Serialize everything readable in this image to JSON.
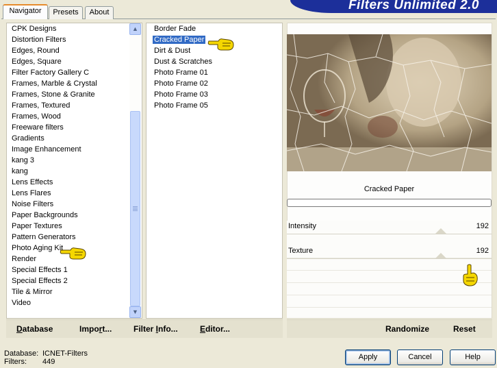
{
  "banner": {
    "title": "Filters Unlimited 2.0"
  },
  "tabs": [
    {
      "label": "Navigator",
      "active": true
    },
    {
      "label": "Presets",
      "active": false
    },
    {
      "label": "About",
      "active": false
    }
  ],
  "categories": [
    "CPK Designs",
    "Distortion Filters",
    "Edges, Round",
    "Edges, Square",
    "Filter Factory Gallery C",
    "Frames, Marble & Crystal",
    "Frames, Stone & Granite",
    "Frames, Textured",
    "Frames, Wood",
    "Freeware filters",
    "Gradients",
    "Image Enhancement",
    "kang 3",
    "kang",
    "Lens Effects",
    "Lens Flares",
    "Noise Filters",
    "Paper Backgrounds",
    "Paper Textures",
    "Pattern Generators",
    "Photo Aging Kit",
    "Render",
    "Special Effects 1",
    "Special Effects 2",
    "Tile & Mirror",
    "Video"
  ],
  "filters": [
    {
      "label": "Border Fade",
      "selected": false
    },
    {
      "label": "Cracked Paper",
      "selected": true
    },
    {
      "label": "Dirt & Dust",
      "selected": false
    },
    {
      "label": "Dust & Scratches",
      "selected": false
    },
    {
      "label": "Photo Frame 01",
      "selected": false
    },
    {
      "label": "Photo Frame 02",
      "selected": false
    },
    {
      "label": "Photo Frame 03",
      "selected": false
    },
    {
      "label": "Photo Frame 05",
      "selected": false
    }
  ],
  "bottom_bar": {
    "database": {
      "mnemonic": "D",
      "rest": "atabase"
    },
    "import": {
      "pre": "Impo",
      "mnemonic": "r",
      "rest": "t..."
    },
    "filter_info": {
      "pre": "Filter ",
      "mnemonic": "I",
      "rest": "nfo..."
    },
    "editor": {
      "mnemonic": "E",
      "rest": "ditor..."
    },
    "randomize": "Randomize",
    "reset": "Reset"
  },
  "preview": {
    "filter_name": "Cracked Paper",
    "progress": 0
  },
  "sliders": [
    {
      "label": "Intensity",
      "value": "192",
      "fraction": 0.753
    },
    {
      "label": "Texture",
      "value": "192",
      "fraction": 0.753
    }
  ],
  "status": {
    "database_label": "Database:",
    "database_value": "ICNET-Filters",
    "filters_label": "Filters:",
    "filters_value": "449"
  },
  "buttons": {
    "apply": "Apply",
    "cancel": "Cancel",
    "help": "Help"
  },
  "colors": {
    "banner": "#1c2f9a",
    "selection": "#316ac5",
    "hand": "#f5d700"
  }
}
